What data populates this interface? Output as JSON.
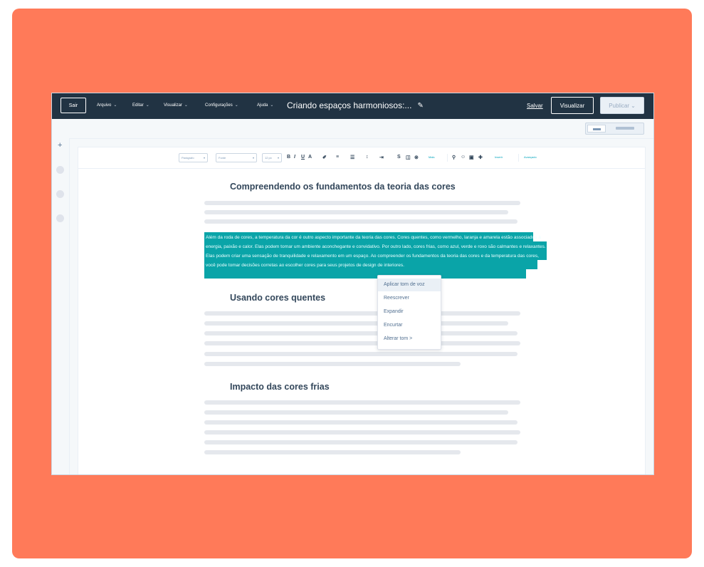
{
  "topbar": {
    "exit_label": "Sair",
    "menus": [
      {
        "label": "Arquivo"
      },
      {
        "label": "Editar"
      },
      {
        "label": "Visualizar"
      },
      {
        "label": "Configurações"
      },
      {
        "label": "Ajuda"
      }
    ],
    "document_title": "Criando espaços harmoniosos:...",
    "save_label": "Salvar",
    "preview_label": "Visualizar",
    "publish_label": "Publicar"
  },
  "toolbar": {
    "paragraph_select": "Parágrafo",
    "font_select": "Fonte",
    "size_select": "12 px",
    "bold": "B",
    "italic": "I",
    "underline": "U",
    "more_label": "Mais",
    "insert_label": "Inserir",
    "advanced_label": "Avançado"
  },
  "content": {
    "heading1": "Compreendendo os fundamentos da teoria das cores",
    "selected_paragraph": "Além da roda de cores, a temperatura da cor é outro aspecto importante da teoria das cores. Cores quentes, como vermelho, laranja e amarela estão associados à energia, paixão e calor. Elas podem tornar um ambiente aconchegante e convidativo. Por outro lado, cores frias, como azul, verde e roxo são calmantes e relaxantes. Elas podem criar uma sensação de tranquilidade e relaxamento em um espaço. Ao compreender os fundamentos da teoria das cores e da temperatura das cores, você pode tomar decisões corretas ao escolher cores para seus projetos de design de interiores.",
    "heading2": "Usando cores quentes",
    "heading3": "Impacto das cores frias"
  },
  "context_menu": {
    "items": [
      {
        "label": "Aplicar tom de voz"
      },
      {
        "label": "Reescrever"
      },
      {
        "label": "Expandir"
      },
      {
        "label": "Encurtar"
      },
      {
        "label": "Alterar tom  >"
      }
    ]
  },
  "colors": {
    "background_frame": "#ff7a59",
    "topbar": "#213343",
    "selection_highlight": "#0aa4a8",
    "accent": "#00a4bd"
  }
}
